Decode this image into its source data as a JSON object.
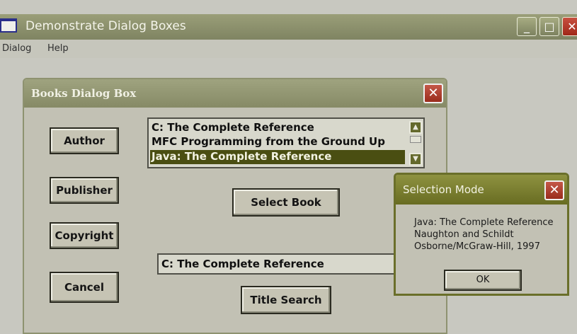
{
  "window": {
    "title": "Demonstrate Dialog Boxes",
    "controls": {
      "minimize": "_",
      "maximize": "□",
      "close": "✕"
    }
  },
  "menubar": {
    "items": [
      "Dialog",
      "Help"
    ]
  },
  "books_dialog": {
    "title": "Books Dialog Box",
    "close": "✕",
    "buttons": {
      "author": "Author",
      "publisher": "Publisher",
      "copyright": "Copyright",
      "cancel": "Cancel",
      "select_book": "Select Book",
      "title_search": "Title Search"
    },
    "list_items": [
      "C: The Complete Reference",
      "MFC Programming from the Ground Up",
      "Java: The Complete Reference"
    ],
    "selected_item": "Java: The Complete Reference",
    "scroll": {
      "up": "▲",
      "down": "▼"
    },
    "edit_value": "C: The Complete Reference"
  },
  "selection_dialog": {
    "title": "Selection Mode",
    "close": "✕",
    "lines": [
      "Java: The Complete Reference",
      "Naughton and Schildt",
      "Osborne/McGraw-Hill, 1997"
    ],
    "ok_label": "OK"
  },
  "colors": {
    "title_bar": "#8a8e6a",
    "selection_title_bar": "#72762a",
    "list_selection": "#4a4e12",
    "close_button": "#b03c2c"
  }
}
